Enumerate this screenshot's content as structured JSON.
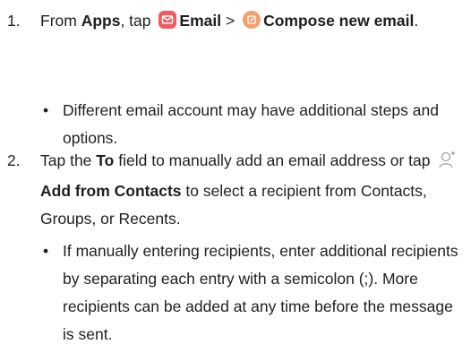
{
  "steps": [
    {
      "number": "1.",
      "t1": "From ",
      "apps": "Apps",
      "t2": ", tap",
      "email": "Email",
      "chevron": ">",
      "compose": "Compose new email",
      "t3": ".",
      "bullet": "Different email account may have additional steps and options."
    },
    {
      "number": "2.",
      "t1": "Tap the ",
      "to": "To",
      "t2": " field to manually add an email address or tap",
      "add": "Add from Contacts",
      "t3": " to select a recipient from Contacts, Groups, or Recents.",
      "bullet": "If manually entering recipients, enter additional recipients by separating each entry with a semicolon (;). More recipients can be added at any time before the message is sent."
    }
  ],
  "bullet_glyph": "•",
  "icons": {
    "email": {
      "name": "email-app-icon",
      "color": "#ef5a5f"
    },
    "compose": {
      "name": "compose-icon",
      "color": "#f4a06b"
    },
    "contacts": {
      "name": "add-contact-icon",
      "color": "#9a9a9a"
    }
  }
}
